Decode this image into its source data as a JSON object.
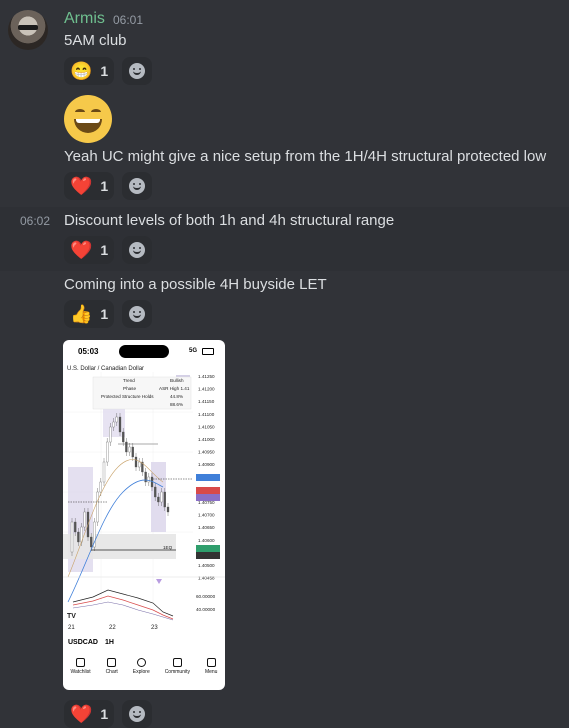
{
  "author": {
    "name": "Armis",
    "time": "06:01"
  },
  "messages": [
    {
      "text": "5AM club"
    },
    {
      "text": "Yeah UC might give a nice setup from the 1H/4H structural protected low"
    },
    {
      "text": "Discount levels of both 1h and 4h structural range",
      "hover_time": "06:02"
    },
    {
      "text": "Coming into a possible 4H buyside LET"
    }
  ],
  "reactions": [
    {
      "emoji": "😁",
      "count": "1"
    },
    {
      "emoji": "❤️",
      "count": "1"
    },
    {
      "emoji": "❤️",
      "count": "1"
    },
    {
      "emoji": "👍",
      "count": "1"
    },
    {
      "emoji": "❤️",
      "count": "1"
    }
  ],
  "phone": {
    "clock": "05:03",
    "signal": "5G",
    "title": "U.S. Dollar / Canadian Dollar",
    "table": [
      [
        "Trend",
        "Bullish"
      ],
      [
        "Phase",
        "ASR High 1.41"
      ],
      [
        "Protected Structure Holds",
        "44.8%"
      ],
      [
        "",
        "88.6%"
      ]
    ],
    "prices": [
      "1.41250",
      "1.41200",
      "1.41150",
      "1.41100",
      "1.41050",
      "1.41000",
      "1.40950",
      "1.40900",
      "1.40850",
      "1.40800",
      "1.40750",
      "1.40700",
      "1.40650",
      "1.40600",
      "1.40550",
      "1.40500",
      "1.40458"
    ],
    "label_1eq": "1EQ",
    "osc_levels": [
      "60.00000",
      "40.00000"
    ],
    "dates": [
      "21",
      "22",
      "23"
    ],
    "symbol": "USDCAD",
    "timeframe": "1H",
    "nav": [
      "Watchlist",
      "Chart",
      "Explore",
      "Community",
      "Menu"
    ]
  }
}
